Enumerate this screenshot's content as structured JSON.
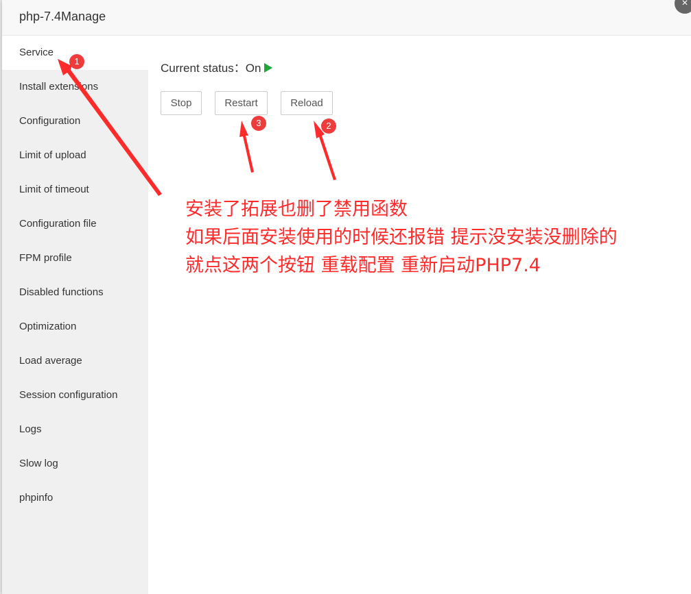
{
  "dialog": {
    "title": "php-7.4Manage",
    "close_label": "×"
  },
  "sidebar": {
    "items": [
      {
        "label": "Service"
      },
      {
        "label": "Install extensions"
      },
      {
        "label": "Configuration"
      },
      {
        "label": "Limit of upload"
      },
      {
        "label": "Limit of timeout"
      },
      {
        "label": "Configuration file"
      },
      {
        "label": "FPM profile"
      },
      {
        "label": "Disabled functions"
      },
      {
        "label": "Optimization"
      },
      {
        "label": "Load average"
      },
      {
        "label": "Session configuration"
      },
      {
        "label": "Logs"
      },
      {
        "label": "Slow log"
      },
      {
        "label": "phpinfo"
      }
    ]
  },
  "service": {
    "status_label": "Current status：",
    "status_value": "On",
    "status_icon": "play-icon",
    "status_color": "#20a53a",
    "buttons": {
      "stop": "Stop",
      "restart": "Restart",
      "reload": "Reload"
    }
  },
  "annotation": {
    "color": "#ff2b2b",
    "lines": [
      "安装了拓展也删了禁用函数",
      "如果后面安装使用的时候还报错 提示没安装没删除的",
      "就点这两个按钮  重载配置  重新启动PHP7.4"
    ],
    "badges": [
      "1",
      "2",
      "3"
    ]
  }
}
